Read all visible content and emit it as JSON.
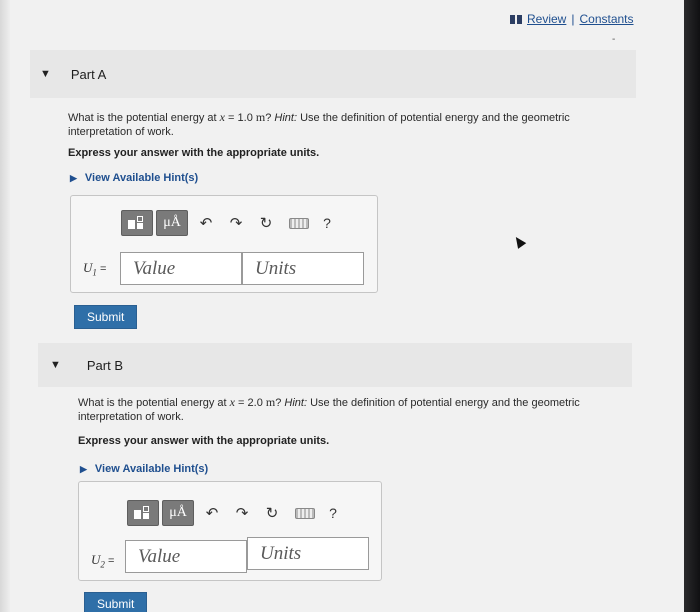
{
  "header": {
    "book_icon": "book-icon",
    "review_label": "Review",
    "separator": "|",
    "constants_label": "Constants",
    "dash": "-"
  },
  "toolbar": {
    "template_icon": "templates-icon",
    "units_symbol": "μÅ",
    "undo_icon": "↶",
    "redo_icon": "↷",
    "reset_icon": "↻",
    "keyboard_icon": "keyboard-icon",
    "help_label": "?"
  },
  "part_a": {
    "caret": "▼",
    "title": "Part A",
    "question_prefix": "What is the potential energy at ",
    "question_var": "x",
    "question_eq": " = 1.0 ",
    "question_unit": "m",
    "question_mid": "? ",
    "question_hint_label": "Hint:",
    "question_rest": " Use the definition of potential energy and the geometric interpretation of work.",
    "express": "Express your answer with the appropriate units.",
    "hints_label": "View Available Hint(s)",
    "var_symbol": "U",
    "var_sub": "1",
    "var_eq": " =",
    "value_placeholder": "Value",
    "units_placeholder": "Units",
    "submit_label": "Submit"
  },
  "part_b": {
    "caret": "▼",
    "title": "Part B",
    "question_prefix": "What is the potential energy at ",
    "question_var": "x",
    "question_eq": " = 2.0 ",
    "question_unit": "m",
    "question_mid": "? ",
    "question_hint_label": "Hint:",
    "question_rest": " Use the definition of potential energy and the geometric interpretation of work.",
    "express": "Express your answer with the appropriate units.",
    "hints_label": "View Available Hint(s)",
    "var_symbol": "U",
    "var_sub": "2",
    "var_eq": " =",
    "value_placeholder": "Value",
    "units_placeholder": "Units",
    "submit_label": "Submit"
  },
  "colors": {
    "link": "#1f4f8f",
    "submit_bg": "#2f6fa8",
    "toolbar_button": "#7a7a7a",
    "page_bg": "#f1f1f1",
    "section_header_bg": "#e7e7e7"
  }
}
